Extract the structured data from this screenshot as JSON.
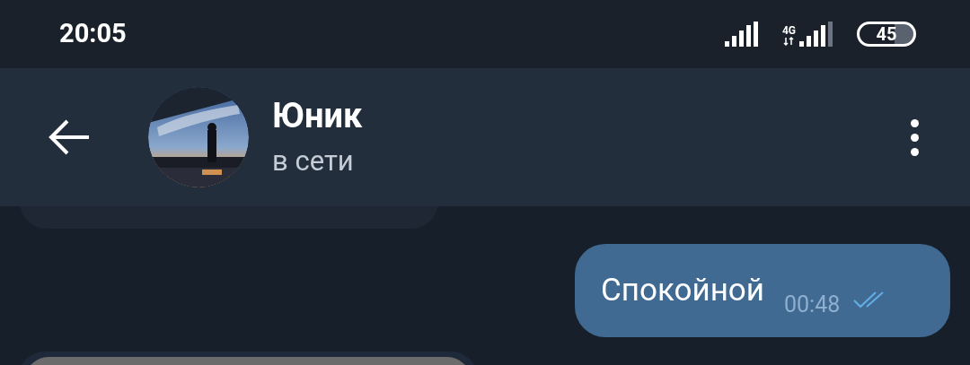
{
  "status_bar": {
    "time": "20:05",
    "network": "4G",
    "battery": "45"
  },
  "header": {
    "title": "Юник",
    "status": "в сети"
  },
  "messages": [
    {
      "kind": "outgoing",
      "text": "Спокойной",
      "time": "00:48",
      "read": true
    }
  ]
}
